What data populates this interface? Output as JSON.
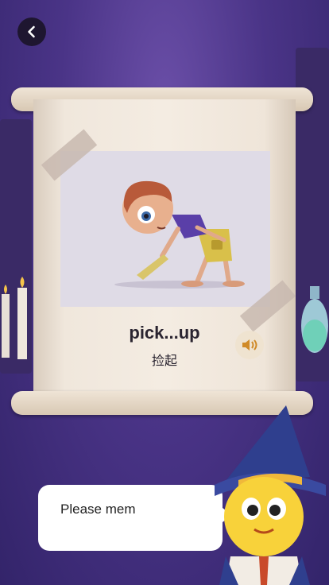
{
  "lesson": {
    "word": "pick...up",
    "translation": "捡起"
  },
  "speech": {
    "text": "Please mem"
  },
  "icons": {
    "back": "back-arrow-icon",
    "sound": "speaker-icon"
  },
  "colors": {
    "background": "#4a3487",
    "scroll": "#f4ece2",
    "card": "#dfdbe6",
    "sound_button": "#efe3d0"
  }
}
